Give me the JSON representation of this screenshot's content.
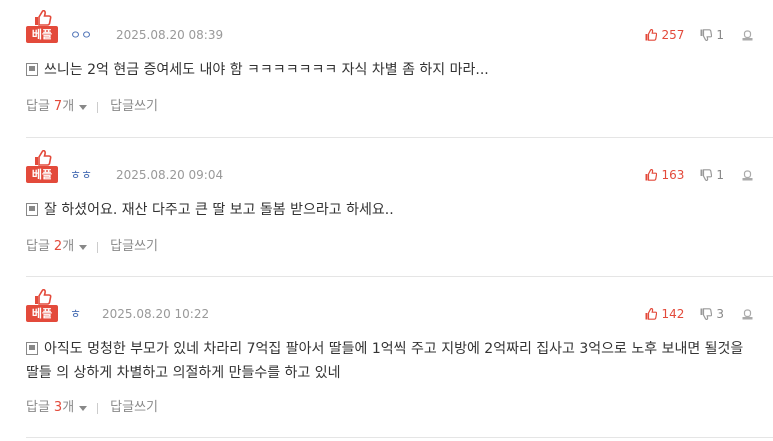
{
  "badge_label": "베플",
  "reply_label": "답글",
  "reply_unit": "개",
  "write_reply_label": "답글쓰기",
  "colors": {
    "accent": "#e34a3b",
    "author": "#4a6fb5",
    "muted": "#999999"
  },
  "comments": [
    {
      "author": "ㅇㅇ",
      "date": "2025.08.20 08:39",
      "likes": "257",
      "dislikes": "1",
      "text": "쓰니는 2억 현금 증여세도 내야 함 ㅋㅋㅋㅋㅋㅋㅋ 자식 차별 좀 하지 마라...",
      "reply_count": "7"
    },
    {
      "author": "ㅎㅎ",
      "date": "2025.08.20 09:04",
      "likes": "163",
      "dislikes": "1",
      "text": "잘 하셨어요. 재산 다주고 큰 딸 보고 돌봄 받으라고 하세요..",
      "reply_count": "2"
    },
    {
      "author": "ㅎ",
      "date": "2025.08.20 10:22",
      "likes": "142",
      "dislikes": "3",
      "text": "아직도 멍청한 부모가 있네 차라리 7억집 팔아서 딸들에 1억씩 주고 지방에 2억짜리 집사고 3억으로 노후 보내면 될것을 딸들 의 상하게 차별하고 의절하게 만들수를 하고 있네",
      "reply_count": "3"
    }
  ]
}
